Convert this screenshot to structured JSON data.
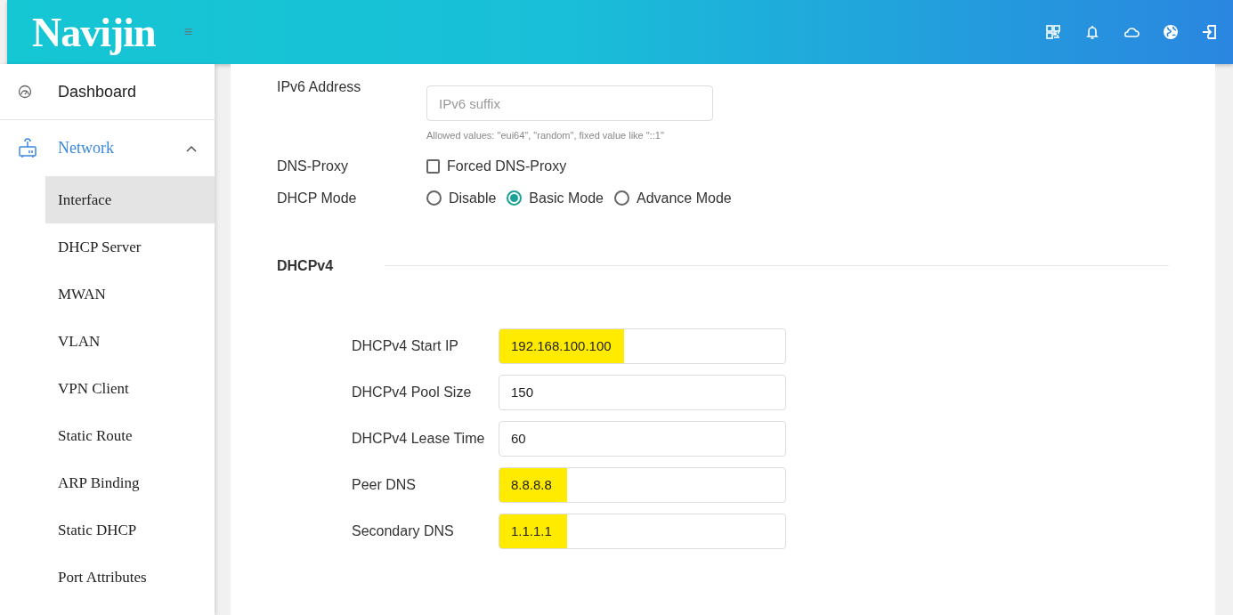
{
  "header": {
    "logo": "Navijin",
    "menu_toggle": "≡"
  },
  "sidebar": {
    "items": [
      {
        "label": "Dashboard",
        "kind": "link",
        "selected": false
      },
      {
        "label": "Network",
        "kind": "group",
        "expanded": true,
        "selected": true,
        "children": [
          {
            "label": "Interface",
            "selected": true
          },
          {
            "label": "DHCP Server",
            "selected": false
          },
          {
            "label": "MWAN",
            "selected": false
          },
          {
            "label": "VLAN",
            "selected": false
          },
          {
            "label": "VPN Client",
            "selected": false
          },
          {
            "label": "Static Route",
            "selected": false
          },
          {
            "label": "ARP Binding",
            "selected": false
          },
          {
            "label": "Static DHCP",
            "selected": false
          },
          {
            "label": "Port Attributes",
            "selected": false
          }
        ]
      }
    ]
  },
  "form": {
    "rows": [
      {
        "kind": "text",
        "label": "IPv6 Address",
        "placeholder": "IPv6 suffix",
        "help": "Allowed values: \"eui64\", \"random\", fixed value like \"::1\""
      },
      {
        "kind": "checkbox",
        "label": "DNS-Proxy",
        "option": "Forced DNS-Proxy",
        "checked": false
      },
      {
        "kind": "radio",
        "label": "DHCP Mode",
        "options": [
          {
            "label": "Disable",
            "selected": false
          },
          {
            "label": "Basic Mode",
            "selected": true
          },
          {
            "label": "Advance Mode",
            "selected": false
          }
        ]
      }
    ]
  },
  "dhcpv4": {
    "title": "DHCPv4",
    "fields": [
      {
        "label": "DHCPv4 Start IP",
        "value": "192.168.100.100",
        "highlighted": true
      },
      {
        "label": "DHCPv4 Pool Size",
        "value": "150",
        "highlighted": false
      },
      {
        "label": "DHCPv4 Lease Time",
        "value": "60",
        "highlighted": false
      },
      {
        "label": "Peer DNS",
        "value": "8.8.8.8",
        "highlighted": true
      },
      {
        "label": "Secondary DNS",
        "value": "1.1.1.1",
        "highlighted": true
      }
    ]
  }
}
